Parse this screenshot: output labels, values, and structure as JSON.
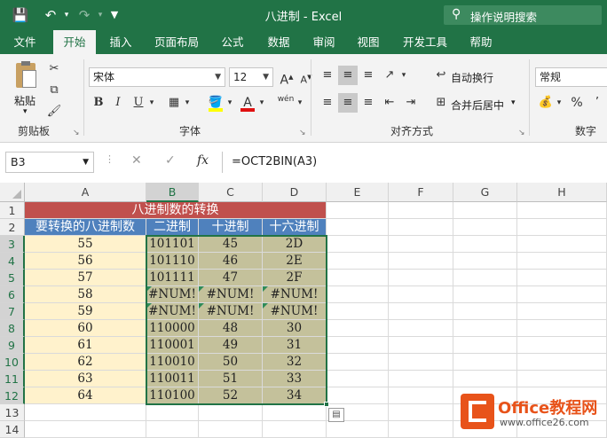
{
  "window": {
    "title": "八进制 - Excel",
    "search_placeholder": "操作说明搜索"
  },
  "tabs": [
    {
      "label": "文件"
    },
    {
      "label": "开始"
    },
    {
      "label": "插入"
    },
    {
      "label": "页面布局"
    },
    {
      "label": "公式"
    },
    {
      "label": "数据"
    },
    {
      "label": "审阅"
    },
    {
      "label": "视图"
    },
    {
      "label": "开发工具"
    },
    {
      "label": "帮助"
    }
  ],
  "active_tab": "开始",
  "ribbon": {
    "clipboard": {
      "paste_label": "粘贴",
      "group_label": "剪贴板"
    },
    "font": {
      "font_name": "宋体",
      "font_size": "12",
      "bold": "B",
      "italic": "I",
      "underline": "U",
      "group_label": "字体",
      "wen": "wén"
    },
    "alignment": {
      "wrap_text": "自动换行",
      "merge_center": "合并后居中",
      "group_label": "对齐方式"
    },
    "number": {
      "format": "常规",
      "percent": "%",
      "group_label": "数字"
    }
  },
  "formula_bar": {
    "name_box": "B3",
    "fx": "fx",
    "formula": "=OCT2BIN(A3)"
  },
  "sheet": {
    "columns": [
      "A",
      "B",
      "C",
      "D",
      "E",
      "F",
      "G",
      "H"
    ],
    "selected_column": "B",
    "rows": [
      "1",
      "2",
      "3",
      "4",
      "5",
      "6",
      "7",
      "8",
      "9",
      "10",
      "11",
      "12",
      "13",
      "14"
    ],
    "title": "八进制数的转换",
    "headers": [
      "要转换的八进制数",
      "二进制",
      "十进制",
      "十六进制"
    ],
    "data": [
      [
        "55",
        "101101",
        "45",
        "2D"
      ],
      [
        "56",
        "101110",
        "46",
        "2E"
      ],
      [
        "57",
        "101111",
        "47",
        "2F"
      ],
      [
        "58",
        "#NUM!",
        "#NUM!",
        "#NUM!"
      ],
      [
        "59",
        "#NUM!",
        "#NUM!",
        "#NUM!"
      ],
      [
        "60",
        "110000",
        "48",
        "30"
      ],
      [
        "61",
        "110001",
        "49",
        "31"
      ],
      [
        "62",
        "110010",
        "50",
        "32"
      ],
      [
        "63",
        "110011",
        "51",
        "33"
      ],
      [
        "64",
        "110100",
        "52",
        "34"
      ]
    ],
    "colors": {
      "title_bg": "#c0504d",
      "header_bg": "#4f81bd",
      "col_a_bg": "#fff2cc",
      "data_bg": "#c4c19b",
      "selection": "#217346"
    }
  },
  "watermark": {
    "name": "Office教程网",
    "url": "www.office26.com"
  }
}
